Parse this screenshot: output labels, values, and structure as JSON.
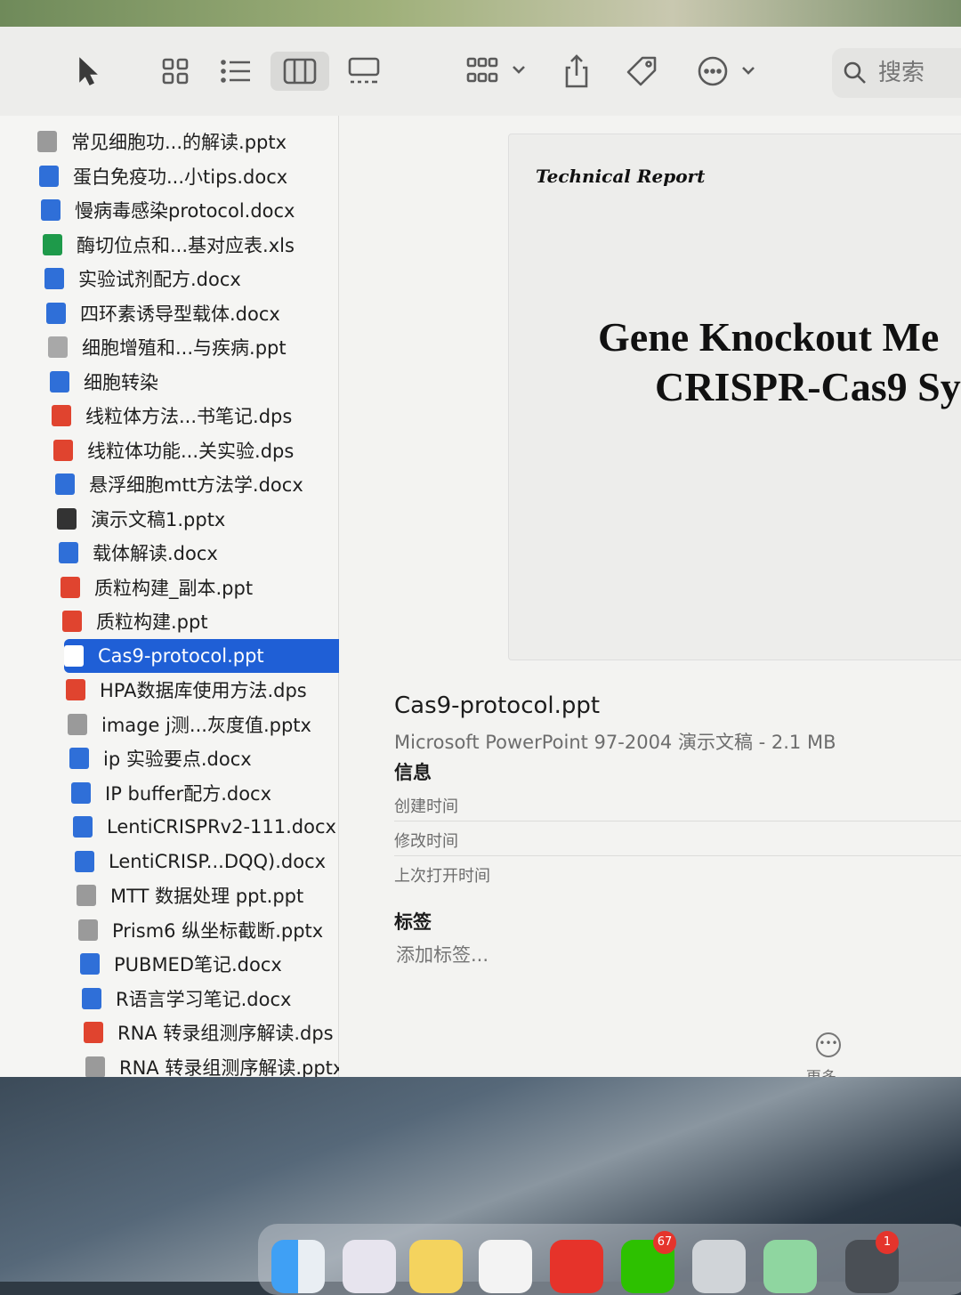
{
  "toolbar": {
    "search_placeholder": "搜索",
    "tools": [
      {
        "icon": "pointer-icon"
      },
      {
        "icon": "grid-view-icon"
      },
      {
        "icon": "list-view-icon"
      },
      {
        "icon": "column-view-icon",
        "active": true
      },
      {
        "icon": "gallery-view-icon"
      },
      {
        "icon": "group-icon"
      },
      {
        "icon": "share-icon"
      },
      {
        "icon": "tag-icon"
      },
      {
        "icon": "more-actions-icon"
      },
      {
        "icon": "search-icon"
      }
    ]
  },
  "files": [
    {
      "name": "常见细胞功...的解读.pptx",
      "type": "pptx"
    },
    {
      "name": "蛋白免疫功...小tips.docx",
      "type": "docx"
    },
    {
      "name": "慢病毒感染protocol.docx",
      "type": "docx"
    },
    {
      "name": "酶切位点和...基对应表.xls",
      "type": "xls"
    },
    {
      "name": "实验试剂配方.docx",
      "type": "docx"
    },
    {
      "name": "四环素诱导型载体.docx",
      "type": "docx"
    },
    {
      "name": "细胞增殖和...与疾病.ppt",
      "type": "ppt-gray"
    },
    {
      "name": "细胞转染",
      "type": "docx"
    },
    {
      "name": "线粒体方法...书笔记.dps",
      "type": "dps"
    },
    {
      "name": "线粒体功能...关实验.dps",
      "type": "dps"
    },
    {
      "name": "悬浮细胞mtt方法学.docx",
      "type": "docx"
    },
    {
      "name": "演示文稿1.pptx",
      "type": "pptx-dark"
    },
    {
      "name": "载体解读.docx",
      "type": "docx"
    },
    {
      "name": "质粒构建_副本.ppt",
      "type": "ppt-red"
    },
    {
      "name": "质粒构建.ppt",
      "type": "ppt-red"
    },
    {
      "name": "Cas9-protocol.ppt",
      "type": "ppt-gray",
      "selected": true
    },
    {
      "name": "HPA数据库使用方法.dps",
      "type": "dps"
    },
    {
      "name": "image j测...灰度值.pptx",
      "type": "pptx"
    },
    {
      "name": "ip 实验要点.docx",
      "type": "docx"
    },
    {
      "name": "IP buffer配方.docx",
      "type": "docx"
    },
    {
      "name": "LentiCRISPRv2-111.docx",
      "type": "docx"
    },
    {
      "name": "LentiCRISP...DQQ).docx",
      "type": "docx"
    },
    {
      "name": "MTT 数据处理 ppt.ppt",
      "type": "pptx"
    },
    {
      "name": "Prism6 纵坐标截断.pptx",
      "type": "pptx"
    },
    {
      "name": "PUBMED笔记.docx",
      "type": "docx"
    },
    {
      "name": "R语言学习笔记.docx",
      "type": "docx"
    },
    {
      "name": "RNA 转录组测序解读.dps",
      "type": "dps"
    },
    {
      "name": "RNA 转录组测序解读.pptx",
      "type": "pptx"
    }
  ],
  "preview": {
    "label": "Technical Report",
    "title_line1": "Gene Knockout Me",
    "title_line2": "CRISPR-Cas9 Sy",
    "filename": "Cas9-protocol.ppt",
    "meta": "Microsoft PowerPoint 97-2004 演示文稿 - 2.1 MB",
    "info_heading": "信息",
    "created_label": "创建时间",
    "modified_label": "修改时间",
    "last_opened_label": "上次打开时间",
    "tags_heading": "标签",
    "tags_placeholder": "添加标签...",
    "more_label": "更多..."
  },
  "dock": {
    "badge_wechat": "67",
    "badge_other": "1"
  },
  "colors": {
    "selection": "#1f5fd6",
    "docx": "#2f6fd8",
    "xls": "#1e9a4a",
    "dps": "#e0442f"
  }
}
